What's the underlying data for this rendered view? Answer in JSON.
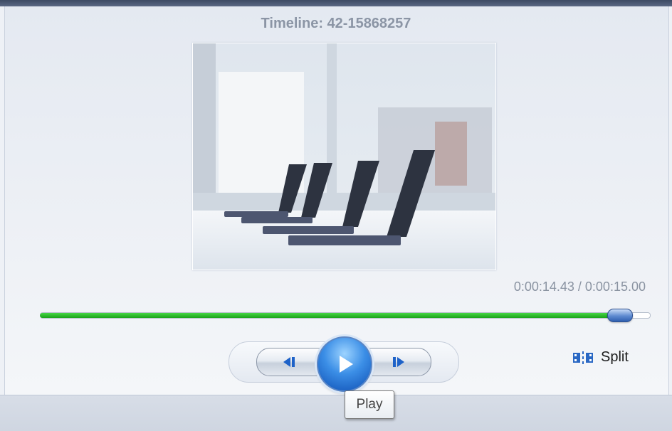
{
  "timeline": {
    "title": "Timeline: 42-15868257"
  },
  "preview": {
    "image_description_icon": "conference-table-laptops-photo"
  },
  "playback": {
    "time_display": "0:00:14.43 / 0:00:15.00",
    "progress": 0.962
  },
  "controls": {
    "previous_icon": "previous-frame-icon",
    "play_icon": "play-icon",
    "next_icon": "next-frame-icon",
    "split_label": "Split",
    "split_icon": "split-icon"
  },
  "tooltip": {
    "text": "Play"
  },
  "colors": {
    "progress_green": "#1aa21a",
    "play_blue": "#3b8ee6"
  }
}
